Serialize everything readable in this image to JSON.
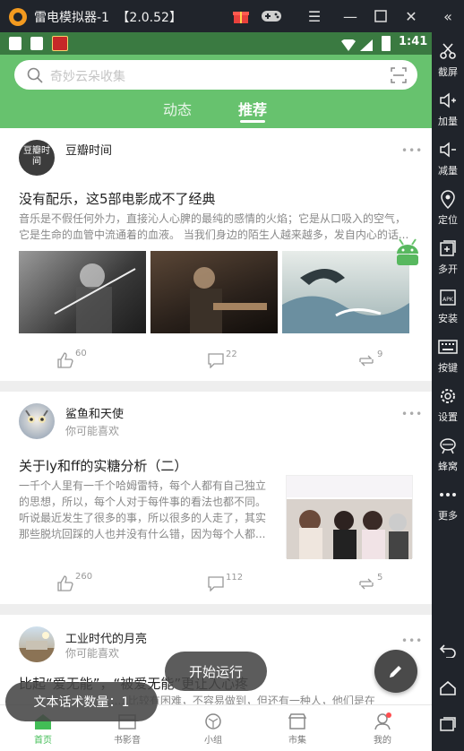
{
  "emulator": {
    "title": "雷电模拟器-1",
    "version": "【2.0.52】",
    "sidebar": [
      {
        "label": "截屏",
        "icon": "scissors-icon"
      },
      {
        "label": "加量",
        "icon": "volume-up-icon"
      },
      {
        "label": "减量",
        "icon": "volume-down-icon"
      },
      {
        "label": "定位",
        "icon": "location-pin-icon"
      },
      {
        "label": "多开",
        "icon": "multi-window-icon"
      },
      {
        "label": "安装",
        "icon": "apk-install-icon"
      },
      {
        "label": "按键",
        "icon": "keyboard-icon"
      },
      {
        "label": "设置",
        "icon": "gear-icon"
      },
      {
        "label": "蜂窝",
        "icon": "beehive-icon"
      },
      {
        "label": "更多",
        "icon": "more-dots-icon"
      }
    ]
  },
  "status_bar": {
    "time": "1:41"
  },
  "search": {
    "placeholder": "奇妙云朵收集"
  },
  "tabs": [
    {
      "label": "动态",
      "active": false
    },
    {
      "label": "推荐",
      "active": true
    }
  ],
  "posts": [
    {
      "author": "豆瓣时间",
      "avatar_text": "豆瓣时间",
      "subtitle": "",
      "title": "没有配乐，这5部电影成不了经典",
      "body": "音乐是不假任何外力，直接沁人心脾的最纯的感情的火焰；它是从口吸入的空气，它是生命的血管中流通着的血液。 当我们身边的陌生人越来越多，发自内心的话...",
      "likes": "60",
      "comments": "22",
      "reposts": "9"
    },
    {
      "author": "鲨鱼和天使",
      "subtitle": "你可能喜欢",
      "title": "关于ly和ff的实糖分析（二）",
      "body": "一千个人里有一千个哈姆雷特，每个人都有自己独立的思想，所以，每个人对于每件事的看法也都不同。听说最近发生了很多的事，所以很多的人走了，其实那些脱坑回踩的人也并没有什么错，因为每个人都...",
      "likes": "260",
      "comments": "112",
      "reposts": "5"
    },
    {
      "author": "工业时代的月亮",
      "subtitle": "你可能喜欢",
      "title": "比起“爱无能”，“被爱无能”更让人心疼",
      "body": "......比较有困难，不容易做到，但还有一种人，他们是在"
    }
  ],
  "bottom_nav": [
    {
      "label": "首页",
      "icon": "home-icon",
      "active": true
    },
    {
      "label": "书影音",
      "icon": "film-icon",
      "active": false
    },
    {
      "label": "小组",
      "icon": "group-icon",
      "active": false
    },
    {
      "label": "市集",
      "icon": "market-icon",
      "active": false
    },
    {
      "label": "我的",
      "icon": "profile-icon",
      "active": false
    }
  ],
  "overlays": {
    "run_button": "开始运行",
    "script_count": "文本话术数量：1"
  },
  "colors": {
    "header_green": "#67c26e",
    "status_green": "#3a7a41",
    "accent_green": "#42bd56",
    "fab": "#4a4a4a"
  }
}
